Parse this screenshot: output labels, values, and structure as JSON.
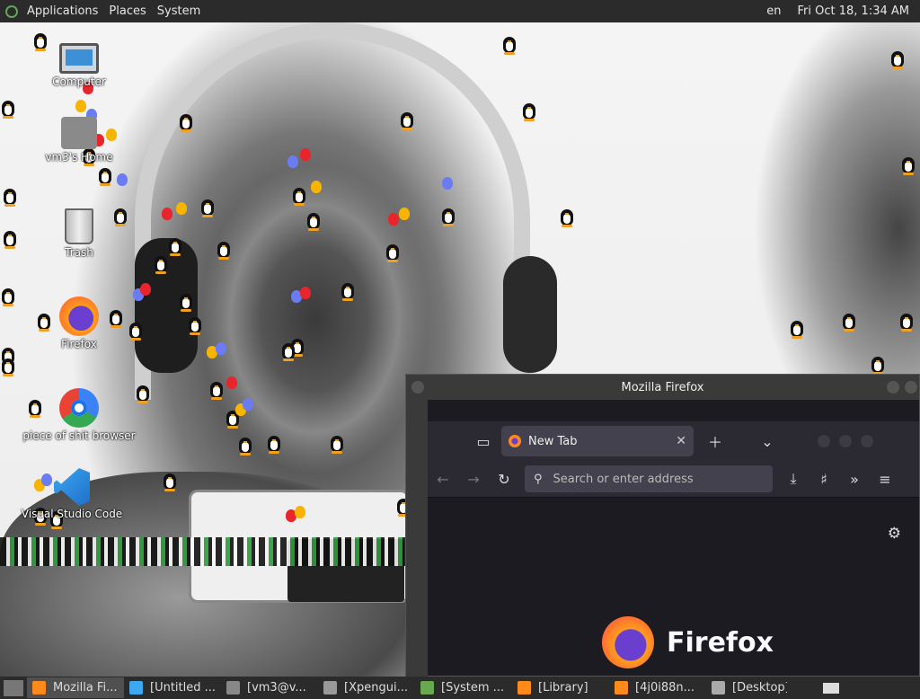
{
  "top_panel": {
    "menus": [
      "Applications",
      "Places",
      "System"
    ],
    "keyboard_layout": "en",
    "clock": "Fri Oct 18,  1:34 AM"
  },
  "desktop_icons": [
    {
      "label": "Computer",
      "icon": "computer-icon"
    },
    {
      "label": "vm3's Home",
      "icon": "home-folder-icon"
    },
    {
      "label": "Trash",
      "icon": "trash-icon"
    },
    {
      "label": "Firefox",
      "icon": "firefox-icon"
    },
    {
      "label": "piece of shit browser",
      "icon": "chrome-icon"
    },
    {
      "label": "Visual Studio Code",
      "icon": "vscode-icon"
    }
  ],
  "firefox_window": {
    "title": "Mozilla Firefox",
    "tab_label": "New Tab",
    "url_placeholder": "Search or enter address",
    "brand_text": "Firefox"
  },
  "taskbar": {
    "items": [
      {
        "label": "Mozilla Fi...",
        "active": true,
        "icon": "firefox-icon",
        "color": "#ff8a1c"
      },
      {
        "label": "[Untitled ...",
        "active": false,
        "icon": "vscode-icon",
        "color": "#3da7f0"
      },
      {
        "label": "[vm3@v...",
        "active": false,
        "icon": "terminal-icon",
        "color": "#888888"
      },
      {
        "label": "[Xpengui...",
        "active": false,
        "icon": "window-icon",
        "color": "#999999"
      },
      {
        "label": "[System ...",
        "active": false,
        "icon": "system-monitor-icon",
        "color": "#6aa84f"
      },
      {
        "label": "[Library]",
        "active": false,
        "icon": "firefox-icon",
        "color": "#ff8a1c"
      },
      {
        "label": "[4j0i88n...",
        "active": false,
        "icon": "firefox-icon",
        "color": "#ff8a1c"
      },
      {
        "label": "[Desktop]",
        "active": false,
        "icon": "folder-icon",
        "color": "#aaaaaa"
      }
    ]
  },
  "colors": {
    "panel_bg": "#2b2b2b",
    "firefox_bg": "#1c1b22",
    "firefox_toolbar": "#2b2a33"
  }
}
